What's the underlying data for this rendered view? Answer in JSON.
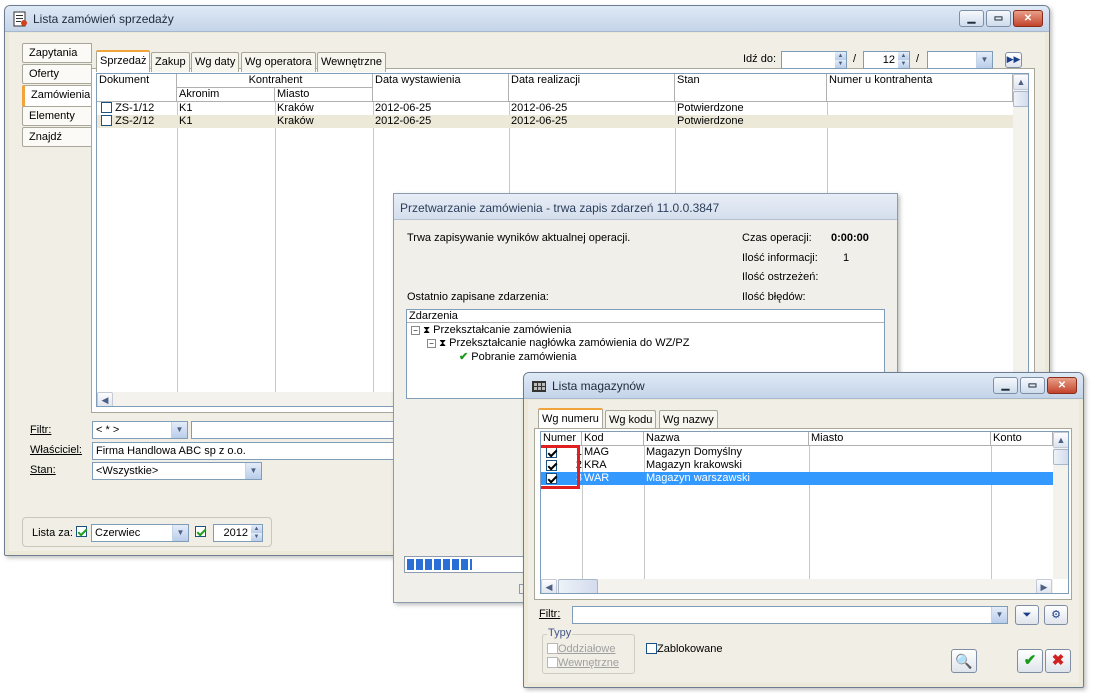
{
  "main_window": {
    "title": "Lista zamówień sprzedaży",
    "vtabs": [
      "Zapytania",
      "Oferty",
      "Zamówienia",
      "Elementy",
      "Znajdź"
    ],
    "htabs": [
      "Sprzedaż",
      "Zakup",
      "Wg daty",
      "Wg operatora",
      "Wewnętrzne"
    ],
    "goto_label": "Idź do:",
    "goto_month": "12",
    "goto_sep": "/",
    "columns": {
      "dokument": "Dokument",
      "kontrahent": "Kontrahent",
      "akronim": "Akronim",
      "miasto": "Miasto",
      "data_wyst": "Data wystawienia",
      "data_real": "Data realizacji",
      "stan": "Stan",
      "numer_kontr": "Numer u kontrahenta"
    },
    "rows": [
      {
        "dokument": "ZS-1/12",
        "akronim": "K1",
        "miasto": "Kraków",
        "data_wyst": "2012-06-25",
        "data_real": "2012-06-25",
        "stan": "Potwierdzone"
      },
      {
        "dokument": "ZS-2/12",
        "akronim": "K1",
        "miasto": "Kraków",
        "data_wyst": "2012-06-25",
        "data_real": "2012-06-25",
        "stan": "Potwierdzone"
      }
    ],
    "filtr_label": "Filtr:",
    "filtr_value": "< * >",
    "wlasciciel_label": "Właściciel:",
    "wlasciciel_value": "Firma Handlowa ABC sp z o.o.",
    "stan_label": "Stan:",
    "stan_value": "<Wszystkie>",
    "lista_za_label": "Lista za:",
    "month_value": "Czerwiec",
    "year_value": "2012"
  },
  "progress_window": {
    "title": "Przetwarzanie zamówienia - trwa zapis zdarzeń 11.0.0.3847",
    "status_text": "Trwa zapisywanie wyników aktualnej operacji.",
    "czas_label": "Czas operacji:",
    "czas_value": "0:00:00",
    "info_label": "Ilość informacji:",
    "info_value": "1",
    "ostrzezen_label": "Ilość ostrzeżeń:",
    "bledow_label": "Ilość błędów:",
    "last_events_label": "Ostatnio zapisane zdarzenia:",
    "tree_header": "Zdarzenia",
    "tree": [
      "Przekształcanie zamówienia",
      "Przekształcanie nagłówka zamówienia do WZ/PZ",
      "Pobranie zamówienia"
    ],
    "progress_fraction": 0.55
  },
  "warehouse_window": {
    "title": "Lista magazynów",
    "tabs": [
      "Wg numeru",
      "Wg kodu",
      "Wg nazwy"
    ],
    "columns": [
      "Numer",
      "Kod",
      "Nazwa",
      "Miasto",
      "Konto"
    ],
    "rows": [
      {
        "numer": "1",
        "kod": "MAG",
        "nazwa": "Magazyn Domyślny",
        "checked": true
      },
      {
        "numer": "2",
        "kod": "KRA",
        "nazwa": "Magazyn krakowski",
        "checked": true
      },
      {
        "numer": "3",
        "kod": "WAR",
        "nazwa": "Magazyn warszawski",
        "checked": true
      }
    ],
    "filtr_label": "Filtr:",
    "typy_label": "Typy",
    "oddzialowe_label": "Oddziałowe",
    "wewnetrzne_label": "Wewnętrzne",
    "zablokowane_label": "Zablokowane",
    "colors": {
      "selection": "#3399ff",
      "highlight_box": "#e02020"
    }
  }
}
